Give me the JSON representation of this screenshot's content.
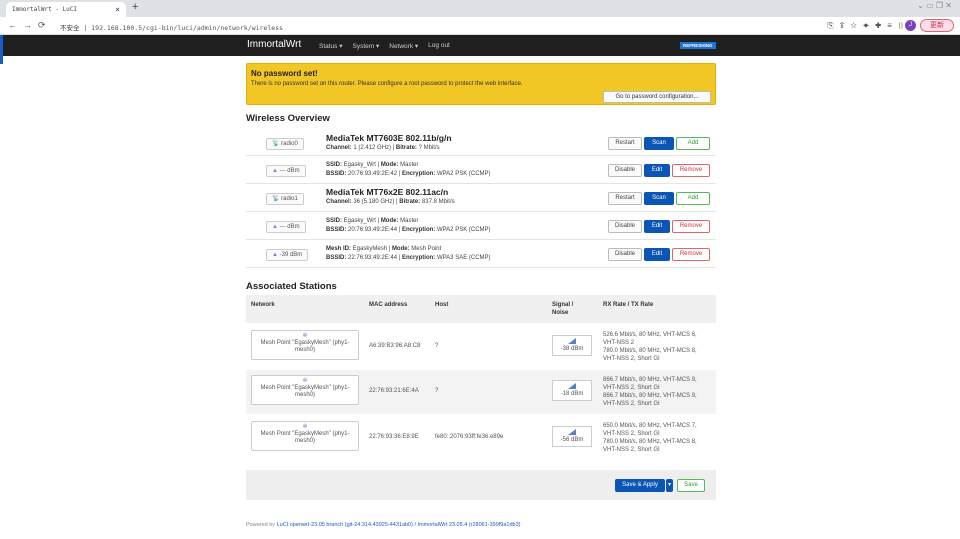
{
  "browser": {
    "tab_title": "ImmortalWrt - LuCI",
    "insecure": "不安全",
    "url": "192.168.100.5/cgi-bin/luci/admin/network/wireless",
    "avatar": "J",
    "update_label": "更新"
  },
  "nav": {
    "brand": "ImmortalWrt",
    "menu": [
      "Status ▾",
      "System ▾",
      "Network ▾",
      "Log out"
    ],
    "refreshing": "REFRESHING"
  },
  "warning": {
    "title": "No password set!",
    "text": "There is no password set on this router. Please configure a root password to protect the web interface.",
    "button": "Go to password configuration..."
  },
  "wireless": {
    "title": "Wireless Overview",
    "rows": [
      {
        "badge": "radio0",
        "line1": "MediaTek MT7603E 802.11b/g/n",
        "l2a": "Channel:",
        "l2b": " 1 (2.412 GHz) | ",
        "l2c": "Bitrate:",
        "l2d": " ? Mbit/s",
        "buttons": [
          "Restart",
          "Scan",
          "Add"
        ],
        "kind": "radio"
      },
      {
        "badge": "--- dBm",
        "l1a": "SSID:",
        "l1b": " Egasky_Wrt | ",
        "l1c": "Mode:",
        "l1d": " Master",
        "l2a": "BSSID:",
        "l2b": " 20:76:93:49:2E:42 | ",
        "l2c": "Encryption:",
        "l2d": " WPA2 PSK (CCMP)",
        "buttons": [
          "Disable",
          "Edit",
          "Remove"
        ],
        "kind": "net"
      },
      {
        "badge": "radio1",
        "line1": "MediaTek MT76x2E 802.11ac/n",
        "l2a": "Channel:",
        "l2b": " 36 (5.180 GHz) | ",
        "l2c": "Bitrate:",
        "l2d": " 837.8 Mbit/s",
        "buttons": [
          "Restart",
          "Scan",
          "Add"
        ],
        "kind": "radio"
      },
      {
        "badge": "--- dBm",
        "l1a": "SSID:",
        "l1b": " Egasky_Wrt | ",
        "l1c": "Mode:",
        "l1d": " Master",
        "l2a": "BSSID:",
        "l2b": " 20:76:93:49:2E:44 | ",
        "l2c": "Encryption:",
        "l2d": " WPA2 PSK (CCMP)",
        "buttons": [
          "Disable",
          "Edit",
          "Remove"
        ],
        "kind": "net"
      },
      {
        "badge": "-39 dBm",
        "l1a": "Mesh ID:",
        "l1b": " EgaskyMesh | ",
        "l1c": "Mode:",
        "l1d": " Mesh Point",
        "l2a": "BSSID:",
        "l2b": " 22:76:93:49:2E:44 | ",
        "l2c": "Encryption:",
        "l2d": " WPA3 SAE (CCMP)",
        "buttons": [
          "Disable",
          "Edit",
          "Remove"
        ],
        "kind": "net"
      }
    ]
  },
  "stations": {
    "title": "Associated Stations",
    "headers": [
      "Network",
      "MAC address",
      "Host",
      "Signal /\nNoise",
      "RX Rate / TX Rate"
    ],
    "rows": [
      {
        "network": "Mesh Point \"EgaskyMesh\" (phy1-mesh0)",
        "mac": "A6:39:B3:96:A8:C8",
        "host": "?",
        "signal": "-38 dBm",
        "rates": "526.6 Mbit/s, 80 MHz, VHT-MCS 6, VHT-NSS 2\n780.0 Mbit/s, 80 MHz, VHT-MCS 8, VHT-NSS 2, Short GI"
      },
      {
        "network": "Mesh Point \"EgaskyMesh\" (phy1-mesh0)",
        "mac": "22:76:93:21:6E:4A",
        "host": "?",
        "signal": "-18 dBm",
        "rates": "866.7 Mbit/s, 80 MHz, VHT-MCS 9, VHT-NSS 2, Short GI\n866.7 Mbit/s, 80 MHz, VHT-MCS 9, VHT-NSS 2, Short GI"
      },
      {
        "network": "Mesh Point \"EgaskyMesh\" (phy1-mesh0)",
        "mac": "22:76:93:36:E8:9E",
        "host": "fe80::2076:93ff:fe36:e89e",
        "signal": "-56 dBm",
        "rates": "650.0 Mbit/s, 80 MHz, VHT-MCS 7, VHT-NSS 2, Short GI\n780.0 Mbit/s, 80 MHz, VHT-MCS 8, VHT-NSS 2, Short GI"
      }
    ]
  },
  "actions": {
    "save_apply": "Save & Apply",
    "dropdown": "▾",
    "save": "Save"
  },
  "footer": {
    "prefix": "Powered by ",
    "link": "LuCI openwrt-23.05 branch (git-24.314.43925-4431ab0) / ImmortalWrt 23.05.4 (r28061-399f9a1db3)"
  }
}
